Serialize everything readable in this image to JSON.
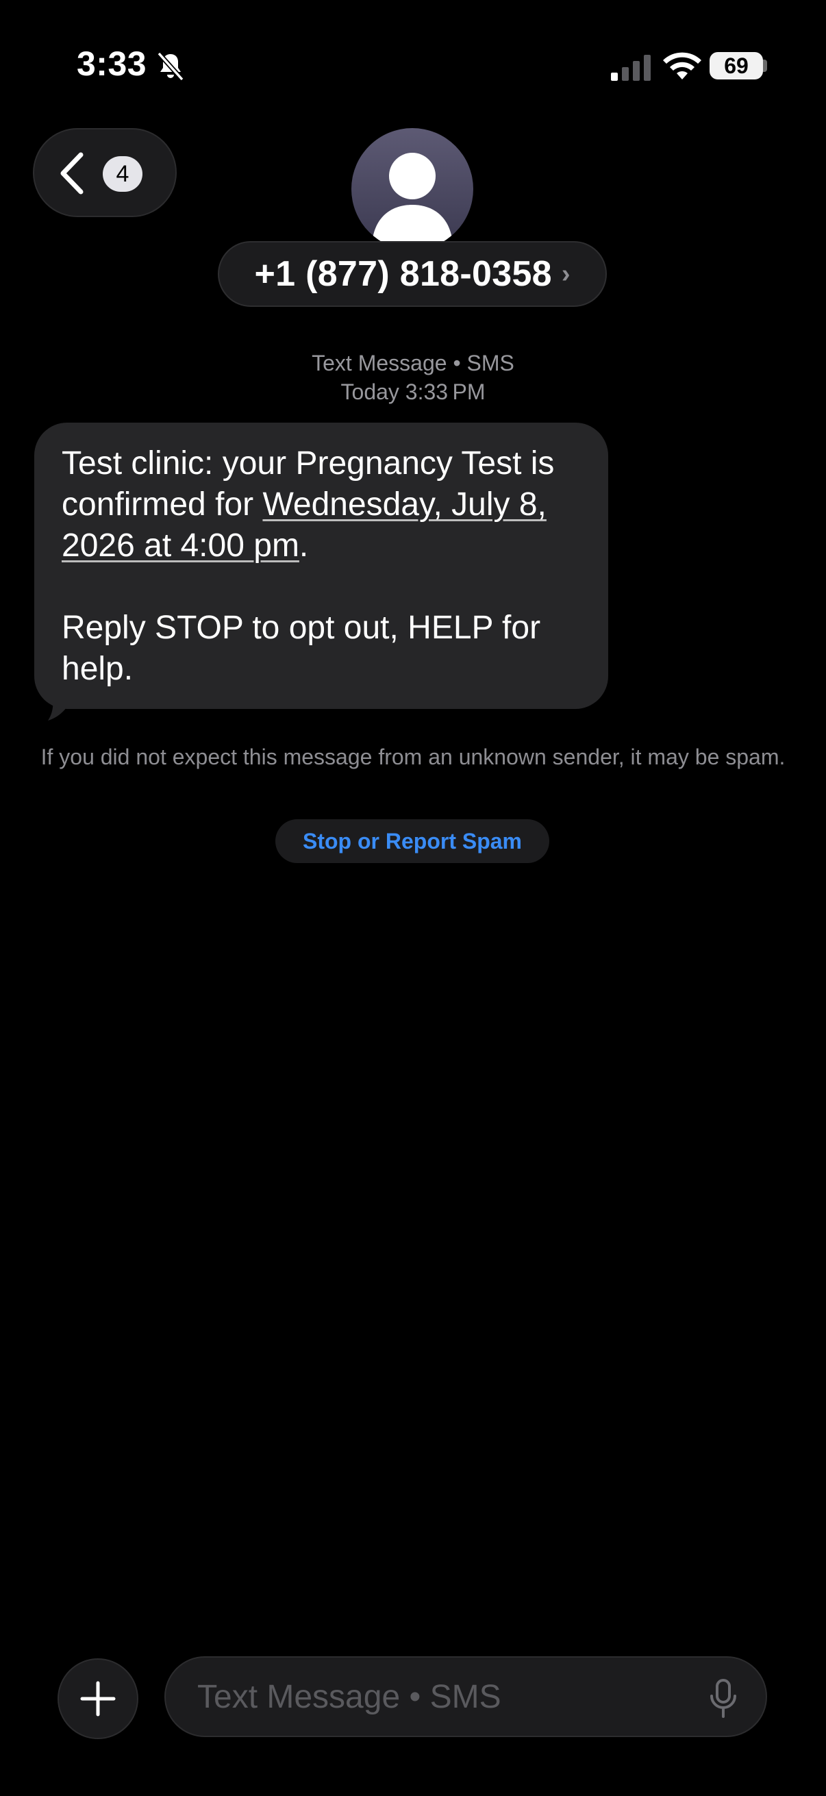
{
  "status_bar": {
    "time": "3:33",
    "battery_level": "69",
    "icons": [
      "bell-slash-icon",
      "cellular-signal-icon",
      "wifi-icon",
      "battery-icon"
    ]
  },
  "nav": {
    "back_count": "4",
    "contact_name": "+1 (877) 818-0358",
    "contact_chevron": "›"
  },
  "conversation": {
    "service_label": "Text Message • SMS",
    "timestamp": "Today 3:33 PM",
    "message": {
      "text_before_date": "Test clinic: your Pregnancy Test is confirmed for ",
      "date_link": "Wednesday, July 8, 2026 at 4:00 pm",
      "text_after_date": ".",
      "reply_text": "Reply STOP to opt out, HELP for help."
    },
    "spam_notice": "If you did not expect this message from an unknown sender, it may be spam.",
    "spam_button_label": "Stop or Report Spam"
  },
  "composer": {
    "placeholder": "Text Message • SMS"
  },
  "colors": {
    "background": "#000000",
    "bubble": "#262628",
    "link_blue": "#3a8cf5",
    "secondary_text": "#98989d"
  }
}
